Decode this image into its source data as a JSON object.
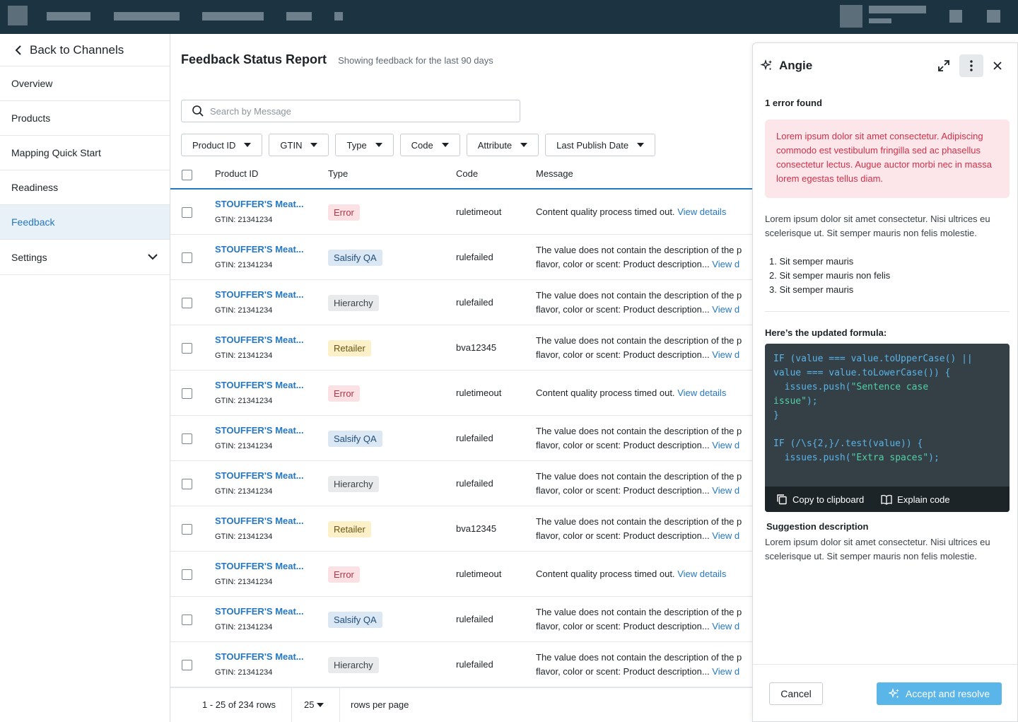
{
  "colors": {
    "topbar": "#1c3442",
    "accent": "#2577c2",
    "error_text": "#d0304a",
    "accept_button": "#5ab6e8"
  },
  "leftnav": {
    "back_label": "Back to Channels",
    "items": [
      {
        "label": "Overview"
      },
      {
        "label": "Products"
      },
      {
        "label": "Mapping Quick Start"
      },
      {
        "label": "Readiness"
      },
      {
        "label": "Feedback",
        "active": true
      },
      {
        "label": "Settings"
      }
    ]
  },
  "main": {
    "title": "Feedback Status Report",
    "subtitle": "Showing feedback for the last 90 days",
    "search_placeholder": "Search by Message",
    "filters": [
      "Product ID",
      "GTIN",
      "Type",
      "Code",
      "Attribute",
      "Last Publish Date"
    ],
    "columns": [
      "Product ID",
      "Type",
      "Code",
      "Message"
    ],
    "rows": [
      {
        "product": "STOUFFER'S Meat...",
        "gtin": "GTIN: 21341234",
        "type": "Error",
        "code": "ruletimeout",
        "msg1": "Content quality process timed out.",
        "msg2": "",
        "link": "View details"
      },
      {
        "product": "STOUFFER'S Meat...",
        "gtin": "GTIN: 21341234",
        "type": "Salsify QA",
        "code": "rulefailed",
        "msg1": "The value does not contain the description of the p",
        "msg2": "flavor, color or scent: Product description...",
        "link": "View d"
      },
      {
        "product": "STOUFFER'S Meat...",
        "gtin": "GTIN: 21341234",
        "type": "Hierarchy",
        "code": "rulefailed",
        "msg1": "The value does not contain the description of the p",
        "msg2": "flavor, color or scent: Product description...",
        "link": "View d"
      },
      {
        "product": "STOUFFER'S Meat...",
        "gtin": "GTIN: 21341234",
        "type": "Retailer",
        "code": "bva12345",
        "msg1": "The value does not contain the description of the p",
        "msg2": "flavor, color or scent: Product description...",
        "link": "View d"
      },
      {
        "product": "STOUFFER'S Meat...",
        "gtin": "GTIN: 21341234",
        "type": "Error",
        "code": "ruletimeout",
        "msg1": "Content quality process timed out.",
        "msg2": "",
        "link": "View details"
      },
      {
        "product": "STOUFFER'S Meat...",
        "gtin": "GTIN: 21341234",
        "type": "Salsify QA",
        "code": "rulefailed",
        "msg1": "The value does not contain the description of the p",
        "msg2": "flavor, color or scent: Product description...",
        "link": "View d"
      },
      {
        "product": "STOUFFER'S Meat...",
        "gtin": "GTIN: 21341234",
        "type": "Hierarchy",
        "code": "rulefailed",
        "msg1": "The value does not contain the description of the p",
        "msg2": "flavor, color or scent: Product description...",
        "link": "View d"
      },
      {
        "product": "STOUFFER'S Meat...",
        "gtin": "GTIN: 21341234",
        "type": "Retailer",
        "code": "bva12345",
        "msg1": "The value does not contain the description of the p",
        "msg2": "flavor, color or scent: Product description...",
        "link": "View d"
      },
      {
        "product": "STOUFFER'S Meat...",
        "gtin": "GTIN: 21341234",
        "type": "Error",
        "code": "ruletimeout",
        "msg1": "Content quality process timed out.",
        "msg2": "",
        "link": "View details"
      },
      {
        "product": "STOUFFER'S Meat...",
        "gtin": "GTIN: 21341234",
        "type": "Salsify QA",
        "code": "rulefailed",
        "msg1": "The value does not contain the description of the p",
        "msg2": "flavor, color or scent: Product description...",
        "link": "View d"
      },
      {
        "product": "STOUFFER'S Meat...",
        "gtin": "GTIN: 21341234",
        "type": "Hierarchy",
        "code": "rulefailed",
        "msg1": "The value does not contain the description of the p",
        "msg2": "flavor, color or scent: Product description...",
        "link": "View d"
      }
    ],
    "pagination": {
      "range": "1 - 25 of 234 rows",
      "page_size": "25",
      "rows_per_page_label": "rows per page"
    }
  },
  "panel": {
    "title": "Angie",
    "error_count": "1 error found",
    "error_text": "Lorem ipsum dolor sit amet consectetur. Adipiscing commodo est vestibulum fringilla sed ac phasellus consectetur lectus. Augue auctor morbi nec in massa lorem egestas tellus diam.",
    "intro": "Lorem ipsum dolor sit amet consectetur. Nisi ultrices eu scelerisque ut. Sit semper mauris non felis molestie.",
    "list": [
      "Sit semper mauris",
      "Sit semper mauris non felis",
      "Sit semper mauris"
    ],
    "formula_label": "Here’s the updated formula:",
    "code": {
      "l1": "IF (value === value.toUpperCase() ||",
      "l2": "value === value.toLowerCase()) {",
      "l3a": "  issues.push(",
      "l3b": "\"Sentence case",
      "l4a": "issue\"",
      "l4b": ");",
      "l5": "}",
      "l6": "IF (/\\s{2,}/.test(value)) {",
      "l7a": "  issues.push(",
      "l7b": "\"Extra spaces\"",
      "l7c": ");"
    },
    "copy_label": "Copy to clipboard",
    "explain_label": "Explain code",
    "suggestion_label": "Suggestion description",
    "suggestion_text": "Lorem ipsum dolor sit amet consectetur. Nisi ultrices eu scelerisque ut. Sit semper mauris non felis molestie.",
    "cancel_label": "Cancel",
    "accept_label": "Accept and resolve"
  }
}
